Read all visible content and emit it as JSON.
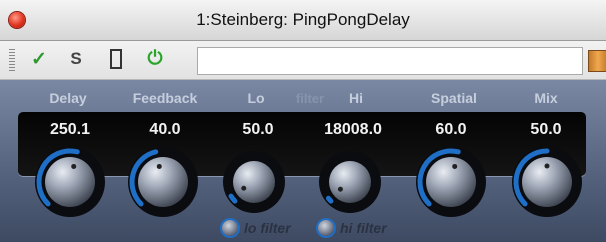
{
  "window": {
    "title": "1:Steinberg: PingPongDelay"
  },
  "toolbar": {
    "bypass_icon": "checkmark-icon",
    "solo_label": "S",
    "edit_icon": "edit-rect-icon",
    "power_icon": "power-icon",
    "preset_value": "",
    "preset_browser_icon": "book-icon"
  },
  "labels": {
    "delay": "Delay",
    "feedback": "Feedback",
    "lo": "Lo",
    "filter": "filter",
    "hi": "Hi",
    "spatial": "Spatial",
    "mix": "Mix"
  },
  "params": [
    {
      "name": "Delay",
      "value": "250.1",
      "level": 0.55
    },
    {
      "name": "Feedback",
      "value": "40.0",
      "level": 0.45
    },
    {
      "name": "Lo",
      "value": "50.0",
      "level": 0.05
    },
    {
      "name": "Hi",
      "value": "18008.0",
      "level": 0.03
    },
    {
      "name": "Spatial",
      "value": "60.0",
      "level": 0.55
    },
    {
      "name": "Mix",
      "value": "50.0",
      "level": 0.5
    }
  ],
  "buttons": {
    "lo_filter": "lo filter",
    "hi_filter": "hi filter"
  },
  "colors": {
    "accent": "#1f6fc6",
    "panel": "#5a6886"
  }
}
